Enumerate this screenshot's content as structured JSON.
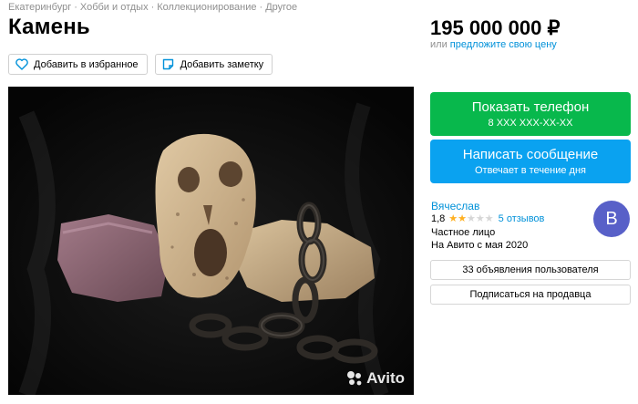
{
  "breadcrumb": {
    "items": [
      "Екатеринбург",
      "Хобби и отдых",
      "Коллекционирование",
      "Другое"
    ],
    "separator": "·"
  },
  "listing": {
    "title": "Камень"
  },
  "actions": {
    "favorite_label": "Добавить в избранное",
    "note_label": "Добавить заметку"
  },
  "photo": {
    "watermark": "Avito"
  },
  "price": {
    "value": "195 000 000 ₽",
    "or_text": "или",
    "offer_link": "предложите свою цену"
  },
  "contact": {
    "phone_label": "Показать телефон",
    "phone_masked": "8 XXX XXX-XX-XX",
    "message_label": "Написать сообщение",
    "message_sub": "Отвечает в течение дня",
    "green_color": "#08b84c",
    "blue_color": "#0aa2f0"
  },
  "seller": {
    "name": "Вячеслав",
    "rating": "1,8",
    "rating_value": 1.8,
    "stars_max": 5,
    "reviews": "5 отзывов",
    "type": "Частное лицо",
    "since": "На Авито с мая 2020",
    "avatar_letter": "В",
    "avatar_color": "#5860c8"
  },
  "seller_actions": {
    "ads_label": "33 объявления пользователя",
    "subscribe_label": "Подписаться на продавца"
  },
  "icons": {
    "favorite": "heart-icon",
    "note": "note-icon",
    "star": "star-icon"
  }
}
